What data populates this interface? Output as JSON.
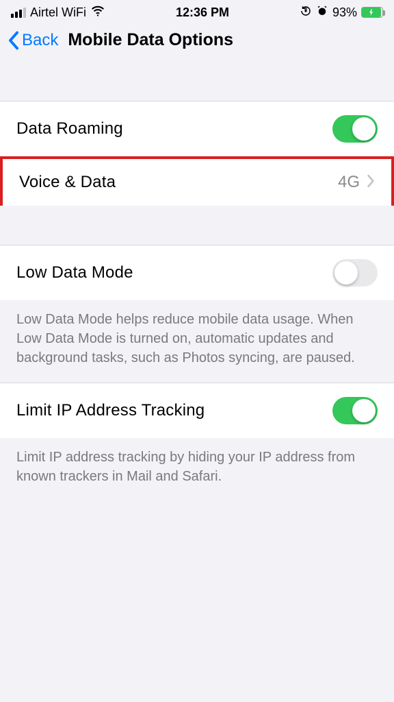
{
  "status": {
    "carrier": "Airtel WiFi",
    "time": "12:36 PM",
    "batteryPercent": "93%"
  },
  "nav": {
    "back": "Back",
    "title": "Mobile Data Options"
  },
  "rows": {
    "dataRoaming": {
      "label": "Data Roaming"
    },
    "voiceData": {
      "label": "Voice & Data",
      "value": "4G"
    },
    "lowDataMode": {
      "label": "Low Data Mode"
    },
    "limitIP": {
      "label": "Limit IP Address Tracking"
    }
  },
  "footers": {
    "lowData": "Low Data Mode helps reduce mobile data usage. When Low Data Mode is turned on, automatic updates and background tasks, such as Photos syncing, are paused.",
    "limitIP": "Limit IP address tracking by hiding your IP address from known trackers in Mail and Safari."
  }
}
